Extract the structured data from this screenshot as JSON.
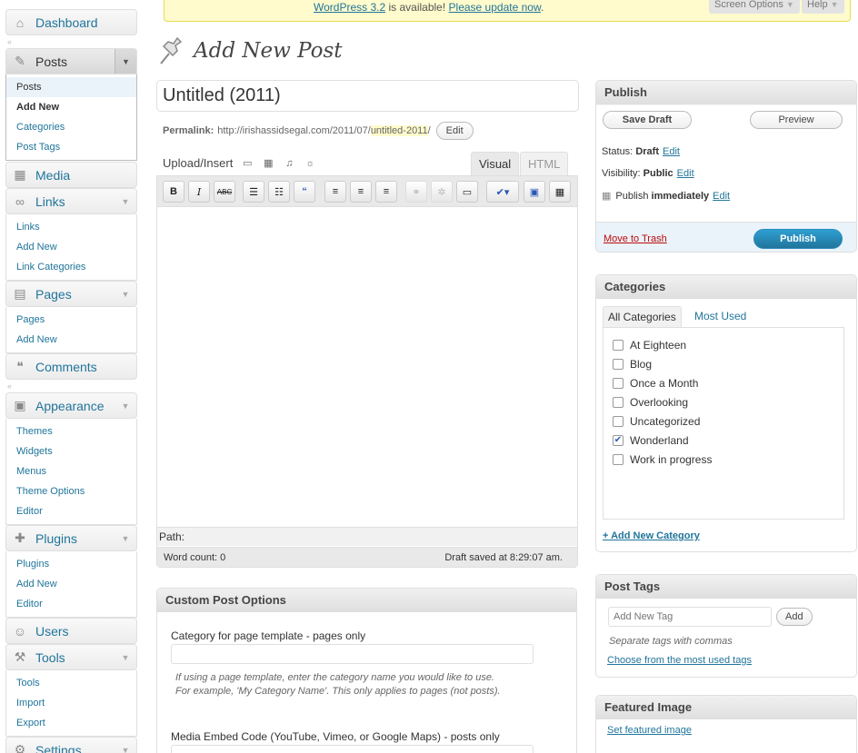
{
  "colors": {
    "link": "#21759b",
    "publish_button": "#21759b",
    "nag_bg": "#fffbcc",
    "trash": "#bc0b0b"
  },
  "nag": {
    "version_link": "WordPress 3.2",
    "middle": " is available! ",
    "update_link": "Please update now",
    "end": "."
  },
  "screen_options": {
    "screen_options_label": "Screen Options",
    "help_label": "Help"
  },
  "sidebar": {
    "dashboard": "Dashboard",
    "posts": {
      "label": "Posts",
      "items": [
        "Posts",
        "Add New",
        "Categories",
        "Post Tags"
      ]
    },
    "media": "Media",
    "links": {
      "label": "Links",
      "items": [
        "Links",
        "Add New",
        "Link Categories"
      ]
    },
    "pages": {
      "label": "Pages",
      "items": [
        "Pages",
        "Add New"
      ]
    },
    "comments": "Comments",
    "appearance": {
      "label": "Appearance",
      "items": [
        "Themes",
        "Widgets",
        "Menus",
        "Theme Options",
        "Editor"
      ]
    },
    "plugins": {
      "label": "Plugins",
      "items": [
        "Plugins",
        "Add New",
        "Editor"
      ]
    },
    "users": "Users",
    "tools": {
      "label": "Tools",
      "items": [
        "Tools",
        "Import",
        "Export"
      ]
    },
    "settings": "Settings"
  },
  "page": {
    "title": "Add New Post"
  },
  "post": {
    "title": "Untitled (2011)",
    "permalink_label": "Permalink:",
    "permalink_base": "http://irishassidsegal.com/2011/07/",
    "permalink_slug": "untitled-2011",
    "permalink_end": "/",
    "edit_button": "Edit"
  },
  "editor": {
    "upload_label": "Upload/Insert",
    "tab_visual": "Visual",
    "tab_html": "HTML",
    "path_label": "Path:",
    "word_count": "Word count: 0",
    "draft_saved": "Draft saved at 8:29:07 am."
  },
  "publish": {
    "title": "Publish",
    "save_draft": "Save Draft",
    "preview": "Preview",
    "status_label": "Status:",
    "status_value": "Draft",
    "visibility_label": "Visibility:",
    "visibility_value": "Public",
    "publish_label": "Publish",
    "publish_value": "immediately",
    "edit": "Edit",
    "move_to_trash": "Move to Trash",
    "publish_button": "Publish"
  },
  "categories": {
    "title": "Categories",
    "tab_all": "All Categories",
    "tab_used": "Most Used",
    "items": [
      {
        "name": "At Eighteen",
        "checked": false
      },
      {
        "name": "Blog",
        "checked": false
      },
      {
        "name": "Once a Month",
        "checked": false
      },
      {
        "name": "Overlooking",
        "checked": false
      },
      {
        "name": "Uncategorized",
        "checked": false
      },
      {
        "name": "Wonderland",
        "checked": true
      },
      {
        "name": "Work in progress",
        "checked": false
      }
    ],
    "add_new": "+ Add New Category"
  },
  "tags": {
    "title": "Post Tags",
    "placeholder": "Add New Tag",
    "add_button": "Add",
    "hint": "Separate tags with commas",
    "choose": "Choose from the most used tags"
  },
  "featured": {
    "title": "Featured Image",
    "link": "Set featured image"
  },
  "custom": {
    "title": "Custom Post Options",
    "field1_label": "Category for page template - pages only",
    "field1_help_1": "If using a page template, enter the category name you would like to use.",
    "field1_help_2": "For example, 'My Category Name'. This only applies to pages (not posts).",
    "field2_label": "Media Embed Code (YouTube, Vimeo, or Google Maps) - posts only"
  }
}
